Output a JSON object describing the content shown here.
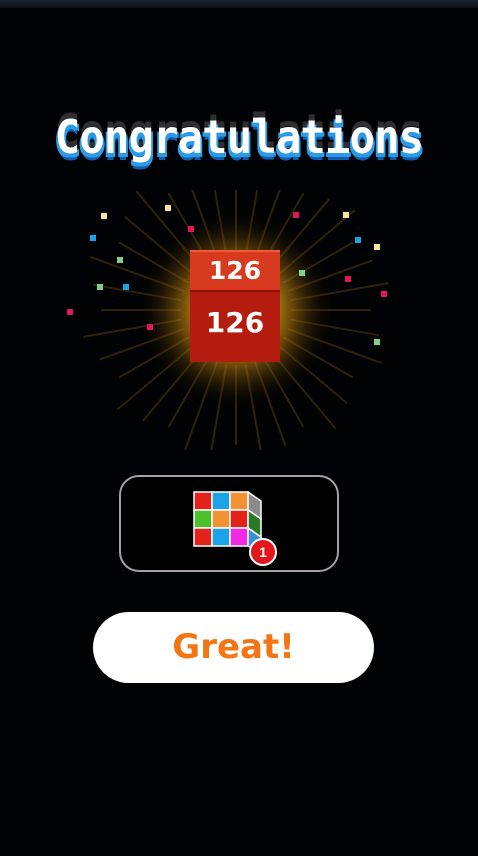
{
  "screen": {
    "title": "Congratulations",
    "merged_block": {
      "top_value": "126",
      "front_value": "126",
      "color": "#b31c0f"
    },
    "reward": {
      "icon": "rubiks-cube-icon",
      "count": "1"
    },
    "confirm_button": {
      "label": "Great!",
      "text_color": "#f47514"
    },
    "colors": {
      "background": "#010203",
      "glow": "#f0b21a",
      "title_shadow": "#2b9be8"
    }
  }
}
